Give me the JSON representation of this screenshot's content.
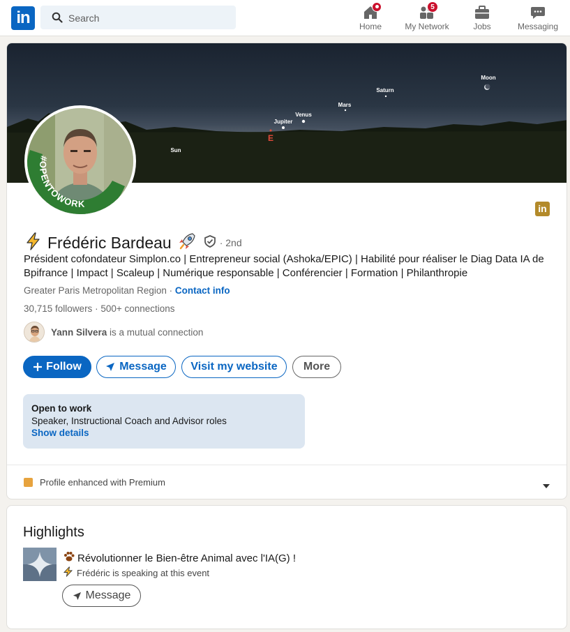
{
  "nav": {
    "search_placeholder": "Search",
    "items": [
      {
        "label": "Home",
        "badge": ""
      },
      {
        "label": "My Network",
        "badge": "5"
      },
      {
        "label": "Jobs",
        "badge": ""
      },
      {
        "label": "Messaging",
        "badge": ""
      }
    ]
  },
  "banner": {
    "planets": [
      "Moon",
      "Saturn",
      "Mars",
      "Venus",
      "Jupiter",
      "Sun"
    ],
    "compass": "E"
  },
  "profile": {
    "frame_text": "#OPENTOWORK",
    "name": "Frédéric Bardeau",
    "degree": "· 2nd",
    "headline": "Président cofondateur Simplon.co | Entrepreneur social (Ashoka/EPIC) | Habilité pour réaliser le Diag Data IA de Bpifrance | Impact | Scaleup | Numérique responsable | Conférencier | Formation | Philanthropie",
    "location": "Greater Paris Metropolitan Region",
    "location_sep": " · ",
    "contact_info": "Contact info",
    "followers": "30,715 followers",
    "connections": "500+ connections",
    "stats_sep": " · ",
    "mutual_name": "Yann Silvera",
    "mutual_text": " is a mutual connection"
  },
  "actions": {
    "follow": "Follow",
    "message": "Message",
    "website": "Visit my website",
    "more": "More"
  },
  "open_to_work": {
    "title": "Open to work",
    "roles": "Speaker, Instructional Coach and Advisor roles",
    "link": "Show details"
  },
  "premium": {
    "label": "Profile enhanced with Premium"
  },
  "highlights": {
    "title": "Highlights",
    "event_title": "Révolutionner le Bien-être Animal avec l'IA(G) !",
    "event_sub": "Frédéric is speaking at this event",
    "message": "Message"
  },
  "colors": {
    "brand": "#0a66c2",
    "badge": "#cb112d",
    "open_to_work_ring": "#2e7d32",
    "open_to_work_bg": "#dce6f1"
  }
}
